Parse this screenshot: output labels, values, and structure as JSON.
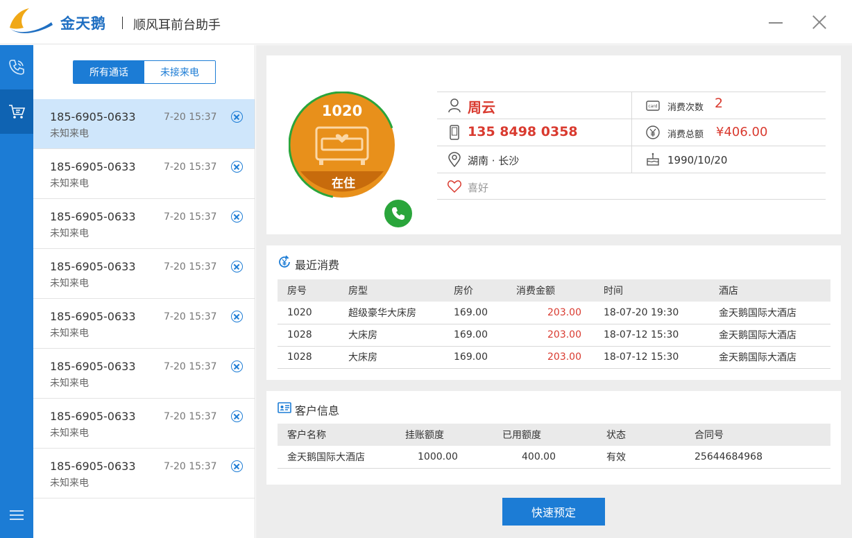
{
  "titlebar": {
    "brand": "金天鹅",
    "app_title": "顺风耳前台助手"
  },
  "tabs": {
    "all": "所有通话",
    "missed": "未接来电"
  },
  "calls": [
    {
      "number": "185-6905-0633",
      "status": "未知来电",
      "time": "7-20  15:37"
    },
    {
      "number": "185-6905-0633",
      "status": "未知来电",
      "time": "7-20  15:37"
    },
    {
      "number": "185-6905-0633",
      "status": "未知来电",
      "time": "7-20  15:37"
    },
    {
      "number": "185-6905-0633",
      "status": "未知来电",
      "time": "7-20  15:37"
    },
    {
      "number": "185-6905-0633",
      "status": "未知来电",
      "time": "7-20  15:37"
    },
    {
      "number": "185-6905-0633",
      "status": "未知来电",
      "time": "7-20  15:37"
    },
    {
      "number": "185-6905-0633",
      "status": "未知来电",
      "time": "7-20  15:37"
    },
    {
      "number": "185-6905-0633",
      "status": "未知来电",
      "time": "7-20  15:37"
    }
  ],
  "profile": {
    "room_number": "1020",
    "room_status": "在住",
    "name": "周云",
    "phone": "135 8498 0358",
    "region": "湖南 · 长沙",
    "hobby_label": "喜好",
    "visits_label": "消费次数",
    "visits_value": "2",
    "total_label": "消费总额",
    "total_value": "¥406.00",
    "birthday": "1990/10/20",
    "card_icon_text": "card"
  },
  "recent": {
    "title": "最近消费",
    "headers": {
      "room": "房号",
      "type": "房型",
      "price": "房价",
      "amount": "消费金额",
      "time": "时间",
      "hotel": "酒店"
    },
    "rows": [
      {
        "room": "1020",
        "type": "超级豪华大床房",
        "price": "169.00",
        "amount": "203.00",
        "time": "18-07-20 19:30",
        "hotel": "金天鹅国际大酒店"
      },
      {
        "room": "1028",
        "type": "大床房",
        "price": "169.00",
        "amount": "203.00",
        "time": "18-07-12 15:30",
        "hotel": "金天鹅国际大酒店"
      },
      {
        "room": "1028",
        "type": "大床房",
        "price": "169.00",
        "amount": "203.00",
        "time": "18-07-12 15:30",
        "hotel": "金天鹅国际大酒店"
      }
    ]
  },
  "customer": {
    "title": "客户信息",
    "headers": {
      "name": "客户名称",
      "credit": "挂账额度",
      "used": "已用额度",
      "state": "状态",
      "contract": "合同号"
    },
    "rows": [
      {
        "name": "金天鹅国际大酒店",
        "credit": "1000.00",
        "used": "400.00",
        "state": "有效",
        "contract": "25644684968"
      }
    ]
  },
  "actions": {
    "quick_book": "快速预定"
  },
  "colors": {
    "primary": "#1c7cd5",
    "accent_red": "#d93a2f",
    "room_orange": "#e8901b",
    "room_green": "#2aa53b"
  }
}
